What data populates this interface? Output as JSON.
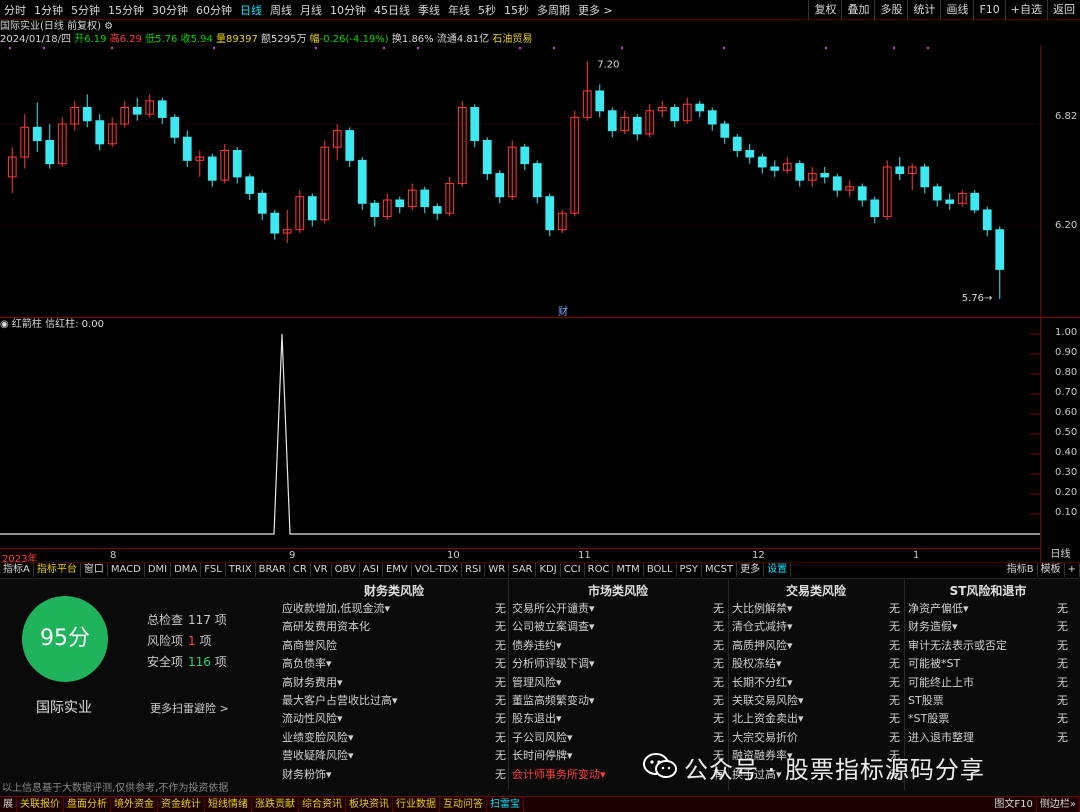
{
  "toolbar": {
    "periods": [
      "分时",
      "1分钟",
      "5分钟",
      "15分钟",
      "30分钟",
      "60分钟",
      "日线",
      "周线",
      "月线",
      "10分钟",
      "45日线",
      "季线",
      "年线",
      "5秒",
      "15秒",
      "多周期",
      "更多 >"
    ],
    "active_index": 6,
    "right_buttons": [
      "复权",
      "叠加",
      "多股",
      "统计",
      "画线",
      "F10",
      "+自选",
      "返回"
    ]
  },
  "info": {
    "title": "国际实业(日线 前复权)",
    "date": "2024/01/18/四",
    "open_label": "开",
    "open": "6.19",
    "high_label": "高",
    "high": "6.29",
    "low_label": "低",
    "low": "5.76",
    "close_label": "收",
    "close": "5.94",
    "volume_label": "量",
    "volume": "89397",
    "amount_label": "额",
    "amount": "5295万",
    "change_label": "幅",
    "change": "-0.26(-4.19%)",
    "turnover_label": "换",
    "turnover": "1.86%",
    "float_label": "流通",
    "float": "4.81亿",
    "sector": "石油贸易"
  },
  "price_axis": {
    "labels": [
      "6.82",
      "6.20"
    ]
  },
  "annotations": {
    "high_mark": "7.20",
    "low_mark": "5.76",
    "fin_marker": "财"
  },
  "indicator": {
    "name": "红箭柱",
    "label": "信红柱",
    "value": "0.00",
    "axis_labels": [
      "1.00",
      "0.90",
      "0.80",
      "0.70",
      "0.60",
      "0.50",
      "0.40",
      "0.30",
      "0.20",
      "0.10"
    ]
  },
  "date_axis": {
    "labels": [
      "2023年",
      "8",
      "9",
      "10",
      "11",
      "12",
      "1"
    ],
    "period": "日线"
  },
  "indicator_tabs": [
    "指标A",
    "指标平台",
    "窗口",
    "MACD",
    "DMI",
    "DMA",
    "FSL",
    "TRIX",
    "BRAR",
    "CR",
    "VR",
    "OBV",
    "ASI",
    "EMV",
    "VOL-TDX",
    "RSI",
    "WR",
    "SAR",
    "KDJ",
    "CCI",
    "ROC",
    "MTM",
    "BOLL",
    "PSY",
    "MCST",
    "更多",
    "设置"
  ],
  "indicator_tabs_right": [
    "指标B",
    "模板",
    "+"
  ],
  "score": {
    "value": "95分",
    "stock_name": "国际实业",
    "total_label": "总检查",
    "total": "117",
    "total_unit": "项",
    "risk_label": "风险项",
    "risk": "1",
    "risk_unit": "项",
    "safe_label": "安全项",
    "safe": "116",
    "safe_unit": "项",
    "more_link": "更多扫雷避险 >"
  },
  "risk_columns": [
    {
      "title": "财务类风险",
      "items": [
        {
          "name": "应收款增加,低现金流▾",
          "value": "无"
        },
        {
          "name": "高研发费用资本化",
          "value": "无"
        },
        {
          "name": "高商誉风险",
          "value": "无"
        },
        {
          "name": "高负债率▾",
          "value": "无"
        },
        {
          "name": "高财务费用▾",
          "value": "无"
        },
        {
          "name": "最大客户占营收比过高▾",
          "value": "无"
        },
        {
          "name": "流动性风险▾",
          "value": "无"
        },
        {
          "name": "业绩变脸风险▾",
          "value": "无"
        },
        {
          "name": "营收疑降风险▾",
          "value": "无"
        },
        {
          "name": "财务粉饰▾",
          "value": "无"
        }
      ]
    },
    {
      "title": "市场类风险",
      "items": [
        {
          "name": "交易所公开谴责▾",
          "value": "无"
        },
        {
          "name": "公司被立案调查▾",
          "value": "无"
        },
        {
          "name": "债券违约▾",
          "value": "无"
        },
        {
          "name": "分析师评级下调▾",
          "value": "无"
        },
        {
          "name": "管理风险▾",
          "value": "无"
        },
        {
          "name": "董监高频繁变动▾",
          "value": "无"
        },
        {
          "name": "股东退出▾",
          "value": "无"
        },
        {
          "name": "子公司风险▾",
          "value": "无"
        },
        {
          "name": "长时间停牌▾",
          "value": "无"
        },
        {
          "name": "会计师事务所变动▾",
          "value": "有",
          "alert": true
        }
      ]
    },
    {
      "title": "交易类风险",
      "items": [
        {
          "name": "大比例解禁▾",
          "value": "无"
        },
        {
          "name": "清仓式减持▾",
          "value": "无"
        },
        {
          "name": "高质押风险▾",
          "value": "无"
        },
        {
          "name": "股权冻结▾",
          "value": "无"
        },
        {
          "name": "长期不分红▾",
          "value": "无"
        },
        {
          "name": "关联交易风险▾",
          "value": "无"
        },
        {
          "name": "北上资金卖出▾",
          "value": "无"
        },
        {
          "name": "大宗交易折价",
          "value": "无"
        },
        {
          "name": "融资融券率▾",
          "value": "无"
        },
        {
          "name": "换手过高▾",
          "value": "无"
        }
      ]
    },
    {
      "title": "ST风险和退市",
      "items": [
        {
          "name": "净资产偏低▾",
          "value": "无"
        },
        {
          "name": "财务造假▾",
          "value": "无"
        },
        {
          "name": "审计无法表示或否定",
          "value": "无"
        },
        {
          "name": "可能被*ST",
          "value": "无"
        },
        {
          "name": "可能终止上市",
          "value": "无"
        },
        {
          "name": "ST股票",
          "value": "无"
        },
        {
          "name": "*ST股票",
          "value": "无"
        },
        {
          "name": "进入退市整理",
          "value": "无"
        }
      ]
    }
  ],
  "disclaimer": "以上信息基于大数据评测,仅供参考,不作为投资依据",
  "watermark": "公众号 · 股票指标源码分享",
  "bottom_nav": [
    "展",
    "关联报价",
    "盘面分析",
    "境外资金",
    "资金统计",
    "短线情绪",
    "涨跌贡献",
    "综合资讯",
    "板块资讯",
    "行业数据",
    "互动问答",
    "扫雷宝"
  ],
  "bottom_nav_right": [
    "图文F10",
    "侧边栏»"
  ],
  "colors": {
    "up": "#ff3b3b",
    "down": "#3ee8f0",
    "score_green": "#1fb35b"
  },
  "chart_data": {
    "type": "candlestick",
    "title": "国际实业(日线 前复权)",
    "x_range": [
      "2023年7月",
      "2024/01/18"
    ],
    "y_range": [
      5.7,
      7.25
    ],
    "candles_approx": [
      {
        "o": 6.5,
        "h": 6.68,
        "l": 6.4,
        "c": 6.62
      },
      {
        "o": 6.62,
        "h": 6.88,
        "l": 6.55,
        "c": 6.8
      },
      {
        "o": 6.8,
        "h": 6.95,
        "l": 6.65,
        "c": 6.72
      },
      {
        "o": 6.72,
        "h": 6.82,
        "l": 6.55,
        "c": 6.58
      },
      {
        "o": 6.58,
        "h": 6.86,
        "l": 6.56,
        "c": 6.82
      },
      {
        "o": 6.82,
        "h": 6.96,
        "l": 6.78,
        "c": 6.92
      },
      {
        "o": 6.92,
        "h": 7.0,
        "l": 6.8,
        "c": 6.84
      },
      {
        "o": 6.84,
        "h": 6.88,
        "l": 6.66,
        "c": 6.7
      },
      {
        "o": 6.7,
        "h": 6.86,
        "l": 6.68,
        "c": 6.82
      },
      {
        "o": 6.82,
        "h": 6.96,
        "l": 6.8,
        "c": 6.92
      },
      {
        "o": 6.92,
        "h": 6.98,
        "l": 6.84,
        "c": 6.88
      },
      {
        "o": 6.88,
        "h": 7.0,
        "l": 6.86,
        "c": 6.96
      },
      {
        "o": 6.96,
        "h": 6.98,
        "l": 6.82,
        "c": 6.86
      },
      {
        "o": 6.86,
        "h": 6.88,
        "l": 6.7,
        "c": 6.74
      },
      {
        "o": 6.74,
        "h": 6.78,
        "l": 6.56,
        "c": 6.6
      },
      {
        "o": 6.6,
        "h": 6.66,
        "l": 6.5,
        "c": 6.62
      },
      {
        "o": 6.62,
        "h": 6.64,
        "l": 6.44,
        "c": 6.48
      },
      {
        "o": 6.48,
        "h": 6.7,
        "l": 6.46,
        "c": 6.66
      },
      {
        "o": 6.66,
        "h": 6.68,
        "l": 6.46,
        "c": 6.5
      },
      {
        "o": 6.5,
        "h": 6.52,
        "l": 6.36,
        "c": 6.4
      },
      {
        "o": 6.4,
        "h": 6.42,
        "l": 6.24,
        "c": 6.28
      },
      {
        "o": 6.28,
        "h": 6.3,
        "l": 6.12,
        "c": 6.16
      },
      {
        "o": 6.16,
        "h": 6.3,
        "l": 6.1,
        "c": 6.18
      },
      {
        "o": 6.18,
        "h": 6.42,
        "l": 6.16,
        "c": 6.38
      },
      {
        "o": 6.38,
        "h": 6.4,
        "l": 6.2,
        "c": 6.24
      },
      {
        "o": 6.24,
        "h": 6.72,
        "l": 6.22,
        "c": 6.68
      },
      {
        "o": 6.68,
        "h": 6.82,
        "l": 6.6,
        "c": 6.78
      },
      {
        "o": 6.78,
        "h": 6.8,
        "l": 6.56,
        "c": 6.6
      },
      {
        "o": 6.6,
        "h": 6.62,
        "l": 6.3,
        "c": 6.34
      },
      {
        "o": 6.34,
        "h": 6.36,
        "l": 6.2,
        "c": 6.26
      },
      {
        "o": 6.26,
        "h": 6.4,
        "l": 6.24,
        "c": 6.36
      },
      {
        "o": 6.36,
        "h": 6.38,
        "l": 6.28,
        "c": 6.32
      },
      {
        "o": 6.32,
        "h": 6.46,
        "l": 6.3,
        "c": 6.42
      },
      {
        "o": 6.42,
        "h": 6.44,
        "l": 6.28,
        "c": 6.32
      },
      {
        "o": 6.32,
        "h": 6.34,
        "l": 6.24,
        "c": 6.28
      },
      {
        "o": 6.28,
        "h": 6.5,
        "l": 6.26,
        "c": 6.46
      },
      {
        "o": 6.46,
        "h": 6.96,
        "l": 6.44,
        "c": 6.92
      },
      {
        "o": 6.92,
        "h": 6.94,
        "l": 6.68,
        "c": 6.72
      },
      {
        "o": 6.72,
        "h": 6.74,
        "l": 6.48,
        "c": 6.52
      },
      {
        "o": 6.52,
        "h": 6.54,
        "l": 6.34,
        "c": 6.38
      },
      {
        "o": 6.38,
        "h": 6.72,
        "l": 6.36,
        "c": 6.68
      },
      {
        "o": 6.68,
        "h": 6.7,
        "l": 6.54,
        "c": 6.58
      },
      {
        "o": 6.58,
        "h": 6.6,
        "l": 6.34,
        "c": 6.38
      },
      {
        "o": 6.38,
        "h": 6.4,
        "l": 6.14,
        "c": 6.18
      },
      {
        "o": 6.18,
        "h": 6.3,
        "l": 6.16,
        "c": 6.28
      },
      {
        "o": 6.28,
        "h": 6.9,
        "l": 6.26,
        "c": 6.86
      },
      {
        "o": 6.86,
        "h": 7.2,
        "l": 6.84,
        "c": 7.02
      },
      {
        "o": 7.02,
        "h": 7.06,
        "l": 6.86,
        "c": 6.9
      },
      {
        "o": 6.9,
        "h": 6.92,
        "l": 6.74,
        "c": 6.78
      },
      {
        "o": 6.78,
        "h": 6.9,
        "l": 6.76,
        "c": 6.86
      },
      {
        "o": 6.86,
        "h": 6.88,
        "l": 6.72,
        "c": 6.76
      },
      {
        "o": 6.76,
        "h": 6.94,
        "l": 6.74,
        "c": 6.9
      },
      {
        "o": 6.9,
        "h": 6.96,
        "l": 6.86,
        "c": 6.92
      },
      {
        "o": 6.92,
        "h": 6.94,
        "l": 6.8,
        "c": 6.84
      },
      {
        "o": 6.84,
        "h": 6.98,
        "l": 6.82,
        "c": 6.94
      },
      {
        "o": 6.94,
        "h": 6.96,
        "l": 6.86,
        "c": 6.9
      },
      {
        "o": 6.9,
        "h": 6.92,
        "l": 6.78,
        "c": 6.82
      },
      {
        "o": 6.82,
        "h": 6.84,
        "l": 6.7,
        "c": 6.74
      },
      {
        "o": 6.74,
        "h": 6.76,
        "l": 6.62,
        "c": 6.66
      },
      {
        "o": 6.66,
        "h": 6.7,
        "l": 6.58,
        "c": 6.62
      },
      {
        "o": 6.62,
        "h": 6.64,
        "l": 6.52,
        "c": 6.56
      },
      {
        "o": 6.56,
        "h": 6.6,
        "l": 6.5,
        "c": 6.54
      },
      {
        "o": 6.54,
        "h": 6.62,
        "l": 6.52,
        "c": 6.58
      },
      {
        "o": 6.58,
        "h": 6.6,
        "l": 6.44,
        "c": 6.48
      },
      {
        "o": 6.48,
        "h": 6.56,
        "l": 6.44,
        "c": 6.52
      },
      {
        "o": 6.52,
        "h": 6.56,
        "l": 6.46,
        "c": 6.5
      },
      {
        "o": 6.5,
        "h": 6.52,
        "l": 6.38,
        "c": 6.42
      },
      {
        "o": 6.42,
        "h": 6.48,
        "l": 6.38,
        "c": 6.44
      },
      {
        "o": 6.44,
        "h": 6.46,
        "l": 6.32,
        "c": 6.36
      },
      {
        "o": 6.36,
        "h": 6.38,
        "l": 6.22,
        "c": 6.26
      },
      {
        "o": 6.26,
        "h": 6.6,
        "l": 6.24,
        "c": 6.56
      },
      {
        "o": 6.56,
        "h": 6.62,
        "l": 6.48,
        "c": 6.52
      },
      {
        "o": 6.52,
        "h": 6.58,
        "l": 6.42,
        "c": 6.56
      },
      {
        "o": 6.56,
        "h": 6.58,
        "l": 6.4,
        "c": 6.44
      },
      {
        "o": 6.44,
        "h": 6.46,
        "l": 6.32,
        "c": 6.36
      },
      {
        "o": 6.36,
        "h": 6.4,
        "l": 6.3,
        "c": 6.34
      },
      {
        "o": 6.34,
        "h": 6.42,
        "l": 6.32,
        "c": 6.4
      },
      {
        "o": 6.4,
        "h": 6.42,
        "l": 6.28,
        "c": 6.3
      },
      {
        "o": 6.3,
        "h": 6.32,
        "l": 6.14,
        "c": 6.18
      },
      {
        "o": 6.18,
        "h": 6.2,
        "l": 5.76,
        "c": 5.94
      }
    ],
    "indicator_series": {
      "name": "信红柱",
      "peak_value": 1.0,
      "peak_position": "2023年9月初",
      "baseline": 0.0
    }
  }
}
